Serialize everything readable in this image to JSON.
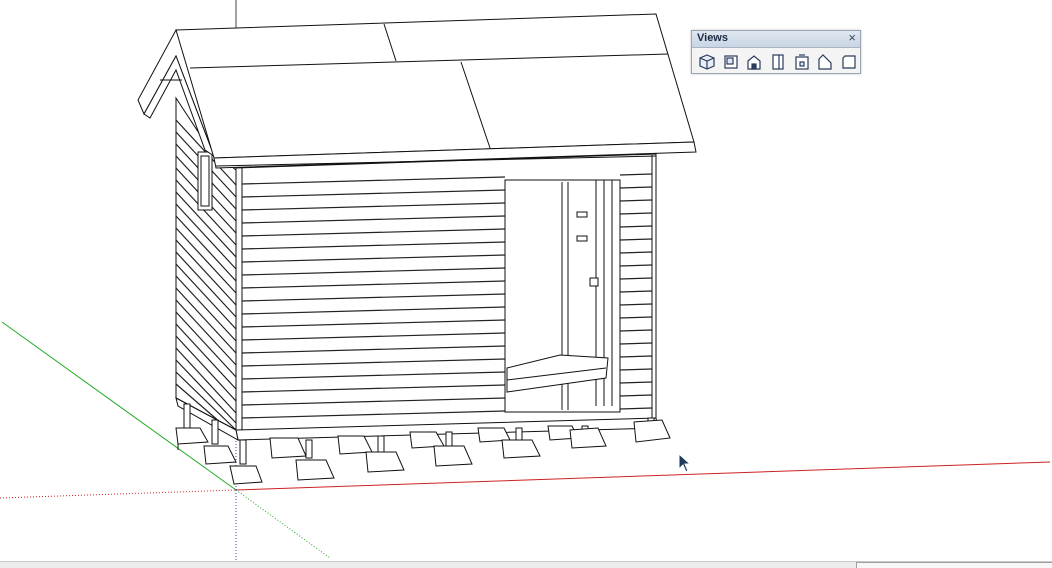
{
  "toolbar": {
    "title": "Views",
    "close_glyph": "×",
    "buttons": [
      {
        "name": "iso-view-button",
        "icon": "iso-view-icon"
      },
      {
        "name": "top-view-button",
        "icon": "top-view-icon"
      },
      {
        "name": "front-view-button",
        "icon": "front-view-icon"
      },
      {
        "name": "right-view-button",
        "icon": "right-view-icon"
      },
      {
        "name": "back-view-button",
        "icon": "back-view-icon"
      },
      {
        "name": "left-view-button",
        "icon": "left-view-icon"
      },
      {
        "name": "bottom-view-button",
        "icon": "bottom-view-icon"
      }
    ]
  },
  "model": {
    "subject": "shed-model",
    "axes_colors": {
      "red": "#cc2222",
      "green": "#22aa22",
      "blue": "#3344bb"
    },
    "line_color": "#111111"
  },
  "cursor": {
    "icon": "arrow-cursor-icon",
    "color": "#1f3a5a"
  }
}
